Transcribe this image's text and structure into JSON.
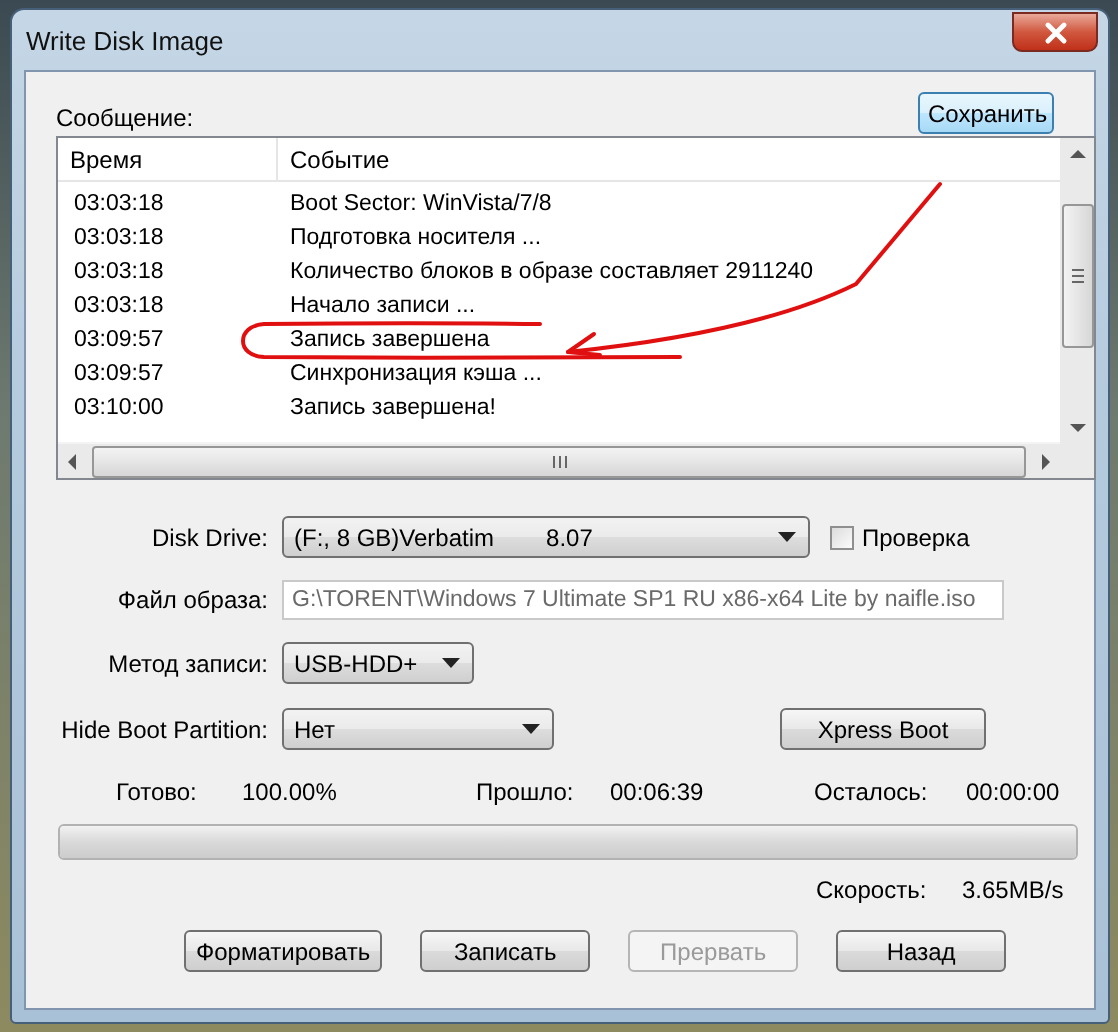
{
  "window": {
    "title": "Write Disk Image"
  },
  "message_label": "Сообщение:",
  "save_button": "Сохранить",
  "log": {
    "columns": [
      "Время",
      "Событие"
    ],
    "rows": [
      {
        "time": "03:03:18",
        "event": "Boot Sector: WinVista/7/8"
      },
      {
        "time": "03:03:18",
        "event": "Подготовка носителя ..."
      },
      {
        "time": "03:03:18",
        "event": "Количество блоков в образе составляет 2911240"
      },
      {
        "time": "03:03:18",
        "event": "Начало записи ..."
      },
      {
        "time": "03:09:57",
        "event": "Запись завершена"
      },
      {
        "time": "03:09:57",
        "event": "Синхронизация кэша ..."
      },
      {
        "time": "03:10:00",
        "event": "Запись завершена!"
      }
    ]
  },
  "disk_drive": {
    "label": "Disk Drive:",
    "value": "(F:, 8 GB)Verbatim",
    "version": "8.07"
  },
  "verify": {
    "label": "Проверка",
    "checked": false
  },
  "image_file": {
    "label": "Файл образа:",
    "value": "G:\\TORENT\\Windows 7 Ultimate SP1 RU x86-x64 Lite by naifle.iso",
    "disabled": true
  },
  "write_method": {
    "label": "Метод записи:",
    "value": "USB-HDD+"
  },
  "hide_boot": {
    "label": "Hide Boot Partition:",
    "value": "Нет"
  },
  "xpress_button": "Xpress Boot",
  "stats": [
    {
      "label": "Готово:",
      "value": "100.00%"
    },
    {
      "label": "Прошло:",
      "value": "00:06:39"
    },
    {
      "label": "Осталось:",
      "value": "00:00:00"
    }
  ],
  "progress": {
    "level": 1
  },
  "speed": {
    "label": "Скорость:",
    "value": "3.65MB/s"
  },
  "buttons": [
    {
      "label": "Форматировать",
      "disabled": false
    },
    {
      "label": "Записать",
      "disabled": false
    },
    {
      "label": "Прервать",
      "disabled": true
    },
    {
      "label": "Назад",
      "disabled": false
    }
  ]
}
